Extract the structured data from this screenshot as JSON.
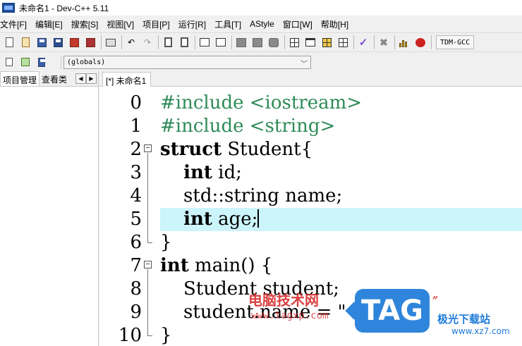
{
  "window": {
    "title": "未命名1 - Dev-C++ 5.11"
  },
  "menu": {
    "items": [
      "文件[F]",
      "编辑[E]",
      "搜索[S]",
      "视图[V]",
      "项目[P]",
      "运行[R]",
      "工具[T]",
      "AStyle",
      "窗口[W]",
      "帮助[H]"
    ]
  },
  "toolbar": {
    "compiler_label": "TDM-GCC",
    "scope_value": "(globals)",
    "icons": [
      "new-file-icon",
      "open-file-icon",
      "save-icon",
      "save-all-icon",
      "close-icon",
      "close-all-icon",
      "print-icon",
      "undo-icon",
      "redo-icon",
      "find-icon",
      "replace-icon",
      "indent-icon",
      "unindent-icon",
      "bookmark-icon",
      "goto-icon",
      "compile-icon",
      "new-project-icon",
      "grid-icon",
      "window-icon",
      "layout-icon",
      "syntax-check-icon",
      "stop-icon",
      "chart-icon",
      "debug-icon"
    ]
  },
  "left_panel": {
    "tabs": [
      "项目管理",
      "查看类"
    ]
  },
  "editor": {
    "tab_label": "[*] 未命名1",
    "highlight_color": "#ccf5fb",
    "lines": [
      {
        "num": "0",
        "text": "#include <iostream>",
        "kind": "pp"
      },
      {
        "num": "1",
        "text": "#include <string>",
        "kind": "pp"
      },
      {
        "num": "2",
        "text": "struct Student{",
        "kind": "code"
      },
      {
        "num": "3",
        "text": "    int id;",
        "kind": "code"
      },
      {
        "num": "4",
        "text": "    std::string name;",
        "kind": "code"
      },
      {
        "num": "5",
        "text": "    int age;",
        "kind": "code"
      },
      {
        "num": "6",
        "text": "}",
        "kind": "code"
      },
      {
        "num": "7",
        "text": "int main() {",
        "kind": "code"
      },
      {
        "num": "8",
        "text": "    Student student;",
        "kind": "code"
      },
      {
        "num": "9",
        "text": "    student.name = \"",
        "kind": "code"
      },
      {
        "num": "10",
        "text": "}",
        "kind": "code"
      }
    ]
  },
  "watermark": {
    "brand_cn": "电脑技术网",
    "brand_url": "www.tagxp.com",
    "tag_logo": "TAG",
    "site_cn": "极光下载站",
    "site_url": "www.xz7.com"
  }
}
